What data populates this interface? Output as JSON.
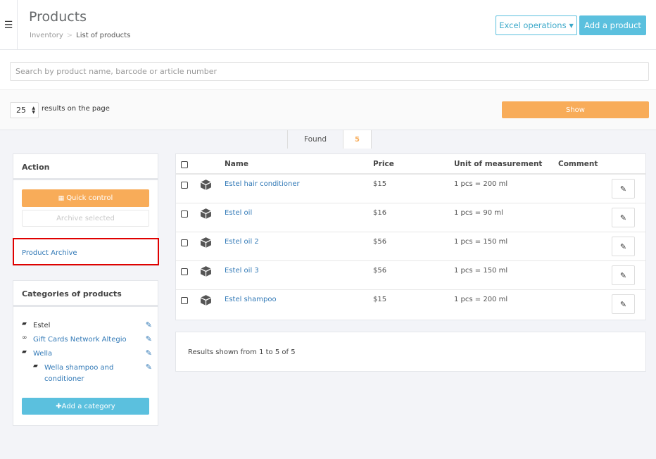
{
  "header": {
    "menu_icon": "☰",
    "title": "Products",
    "breadcrumb": {
      "root": "Inventory",
      "separator": ">",
      "current": "List of products"
    },
    "excel_button": "Excel operations",
    "add_button": "Add a product"
  },
  "search": {
    "placeholder": "Search by product name, barcode or article number"
  },
  "pagination": {
    "per_page": "25",
    "per_page_label": "results on the page",
    "show_button": "Show"
  },
  "found": {
    "label": "Found",
    "count": "5"
  },
  "action_panel": {
    "title": "Action",
    "quick_control": "Quick control",
    "archive_selected": "Archive selected",
    "archive_link": "Product Archive"
  },
  "categories_panel": {
    "title": "Categories of products",
    "items": [
      {
        "label": "Estel",
        "icon": "folder-open-icon"
      },
      {
        "label": "Gift Cards Network Altegio",
        "icon": "link-icon"
      },
      {
        "label": "Wella",
        "icon": "folder-open-icon"
      },
      {
        "label": "Wella shampoo and conditioner",
        "icon": "folder-open-icon"
      }
    ],
    "add_button": "Add a category"
  },
  "table": {
    "columns": {
      "name": "Name",
      "price": "Price",
      "unit": "Unit of measurement",
      "comment": "Comment"
    },
    "rows": [
      {
        "name": "Estel hair conditioner",
        "price": "$15",
        "unit": "1 pcs = 200 ml",
        "comment": ""
      },
      {
        "name": "Estel oil",
        "price": "$16",
        "unit": "1 pcs = 90 ml",
        "comment": ""
      },
      {
        "name": "Estel oil 2",
        "price": "$56",
        "unit": "1 pcs = 150 ml",
        "comment": ""
      },
      {
        "name": "Estel oil 3",
        "price": "$56",
        "unit": "1 pcs = 150 ml",
        "comment": ""
      },
      {
        "name": "Estel shampoo",
        "price": "$15",
        "unit": "1 pcs = 200 ml",
        "comment": ""
      }
    ]
  },
  "results": {
    "text": "Results shown from 1 to 5 of 5"
  },
  "colors": {
    "accent_blue": "#5bc0de",
    "accent_orange": "#f8ac59",
    "link": "#337ab7",
    "highlight": "#e00000"
  }
}
